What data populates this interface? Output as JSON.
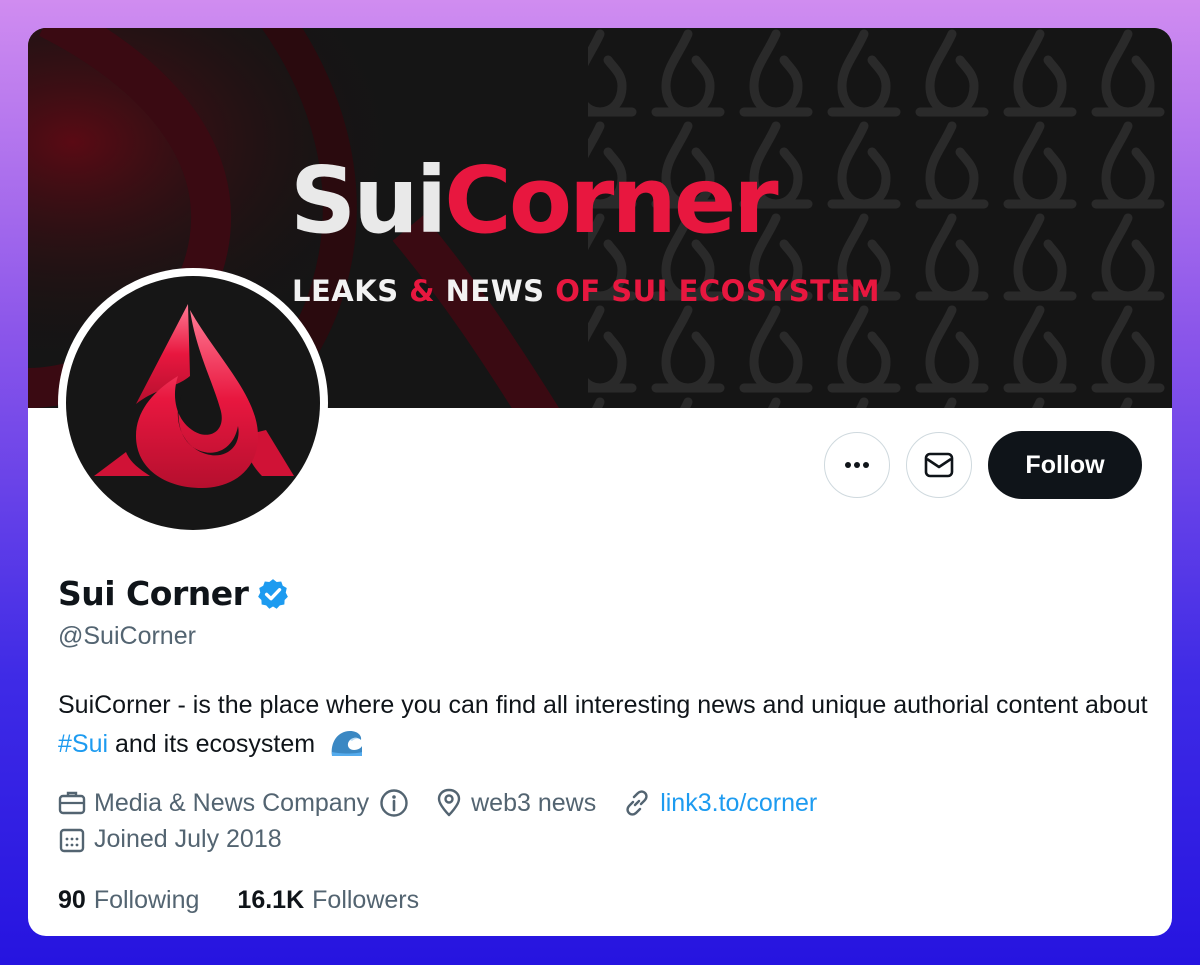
{
  "banner": {
    "title_part1": "Sui",
    "title_part2": "Corner",
    "sub_part1": "LEAKS",
    "sub_part2": "&",
    "sub_part3": "NEWS",
    "sub_part4": "OF SUI ECOSYSTEM"
  },
  "profile": {
    "name": "Sui Corner",
    "handle": "@SuiCorner",
    "bio_text_1": "SuiCorner - is the place where you can find all interesting news and unique authorial content about ",
    "bio_hashtag": "#Sui",
    "bio_text_2": " and its ecosystem",
    "bio_emoji": "wave-emoji",
    "category": "Media & News Company",
    "location": "web3 news",
    "website": "link3.to/corner",
    "joined": "Joined July 2018"
  },
  "stats": {
    "following_count": "90",
    "following_label": "Following",
    "followers_count": "16.1K",
    "followers_label": "Followers"
  },
  "actions": {
    "follow_label": "Follow",
    "more_icon": "more-icon",
    "message_icon": "mail-icon"
  },
  "colors": {
    "accent_red": "#e8173f",
    "link_blue": "#1d9bf0",
    "text_dark": "#0f1419",
    "text_gray": "#536471"
  }
}
